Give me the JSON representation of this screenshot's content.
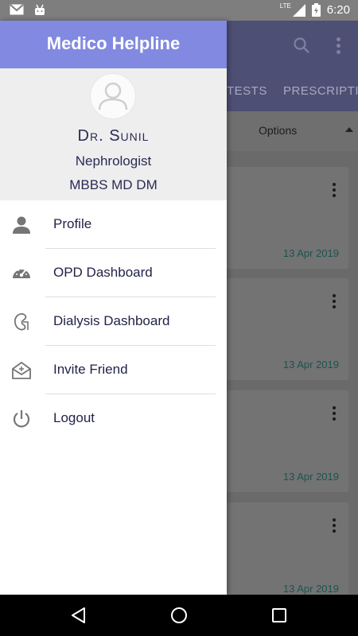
{
  "status_bar": {
    "time": "6:20",
    "network": "LTE",
    "icons": [
      "gmail-icon",
      "android-icon",
      "signal-icon",
      "battery-icon"
    ]
  },
  "background_app": {
    "tabs": [
      "TESTS",
      "PRESCRIPTIO"
    ],
    "options_label": "Options",
    "cards": [
      {
        "date": "13 Apr 2019"
      },
      {
        "date": "13 Apr 2019"
      },
      {
        "date": "13 Apr 2019"
      },
      {
        "date": "13 Apr 2019"
      }
    ]
  },
  "drawer": {
    "title": "Medico Helpline",
    "doctor": {
      "name": "Dr. Sunil",
      "specialty": "Nephrologist",
      "degree": "MBBS MD DM"
    },
    "menu": [
      {
        "label": "Profile",
        "icon": "person-icon"
      },
      {
        "label": "OPD Dashboard",
        "icon": "speedometer-icon"
      },
      {
        "label": "Dialysis Dashboard",
        "icon": "kidney-icon"
      },
      {
        "label": "Invite Friend",
        "icon": "mail-open-icon"
      },
      {
        "label": "Logout",
        "icon": "power-icon"
      }
    ]
  },
  "colors": {
    "drawer_header": "#8189e0",
    "text_primary": "#2a2b55",
    "date_accent": "#1c5350"
  }
}
